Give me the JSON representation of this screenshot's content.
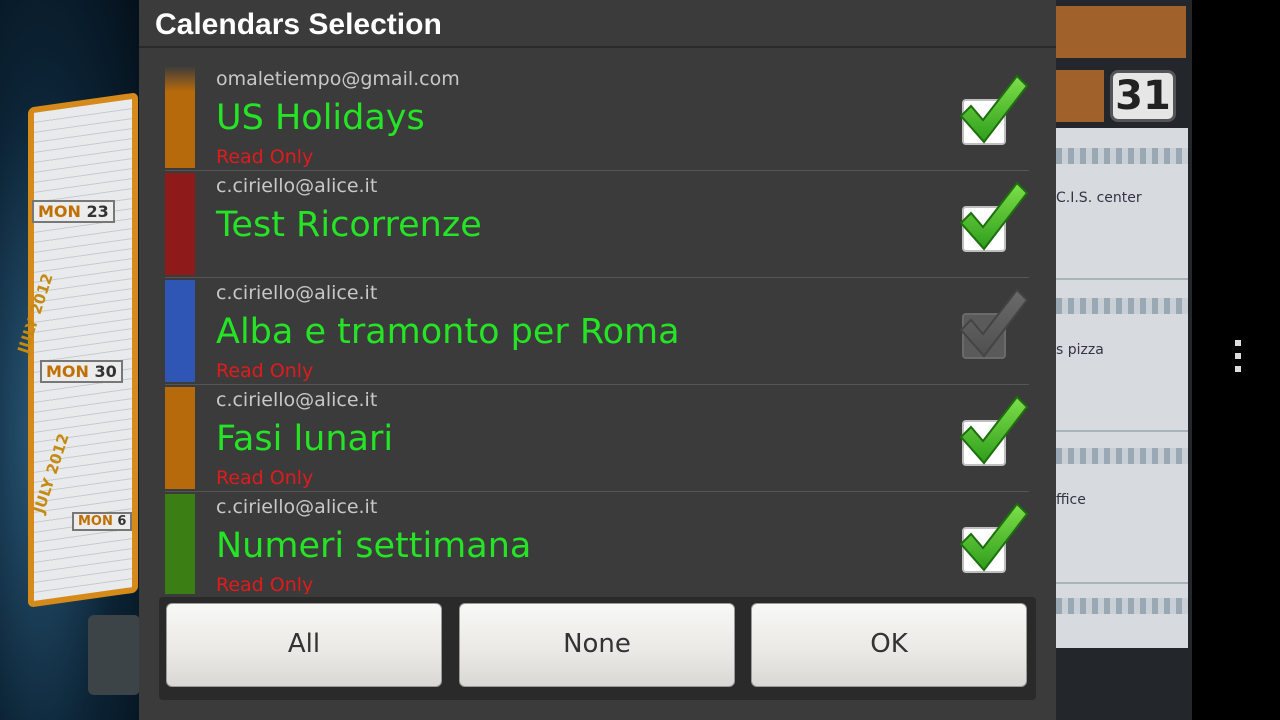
{
  "dialog": {
    "title": "Calendars Selection",
    "calendars": [
      {
        "account": "omaletiempo@gmail.com",
        "name": "US Holidays",
        "status": "Read Only",
        "color": "#b76a0c",
        "checked": true,
        "enabled": true
      },
      {
        "account": "c.ciriello@alice.it",
        "name": "Test Ricorrenze",
        "status": "",
        "color": "#8e1a1a",
        "checked": true,
        "enabled": true
      },
      {
        "account": "c.ciriello@alice.it",
        "name": "Alba e tramonto per Roma",
        "status": "Read Only",
        "color": "#2f56b4",
        "checked": true,
        "enabled": false
      },
      {
        "account": "c.ciriello@alice.it",
        "name": "Fasi lunari",
        "status": "Read Only",
        "color": "#b76a0c",
        "checked": true,
        "enabled": true
      },
      {
        "account": "c.ciriello@alice.it",
        "name": "Numeri settimana",
        "status": "Read Only",
        "color": "#3b7e14",
        "checked": true,
        "enabled": true
      }
    ],
    "buttons": {
      "all": "All",
      "none": "None",
      "ok": "OK"
    }
  },
  "background": {
    "drum_tags": [
      {
        "dow": "MON",
        "day": "23"
      },
      {
        "dow": "MON",
        "day": "30"
      },
      {
        "dow": "MON",
        "day": "6"
      }
    ],
    "drum_months": [
      "JULY 2012",
      "JULY 2012"
    ],
    "day_number": "31",
    "events": [
      "C.I.S. center",
      "s pizza",
      "ffice"
    ]
  },
  "colors": {
    "name_text": "#25e325",
    "read_only_text": "#e01b1b",
    "dialog_bg": "#3b3b3b"
  }
}
